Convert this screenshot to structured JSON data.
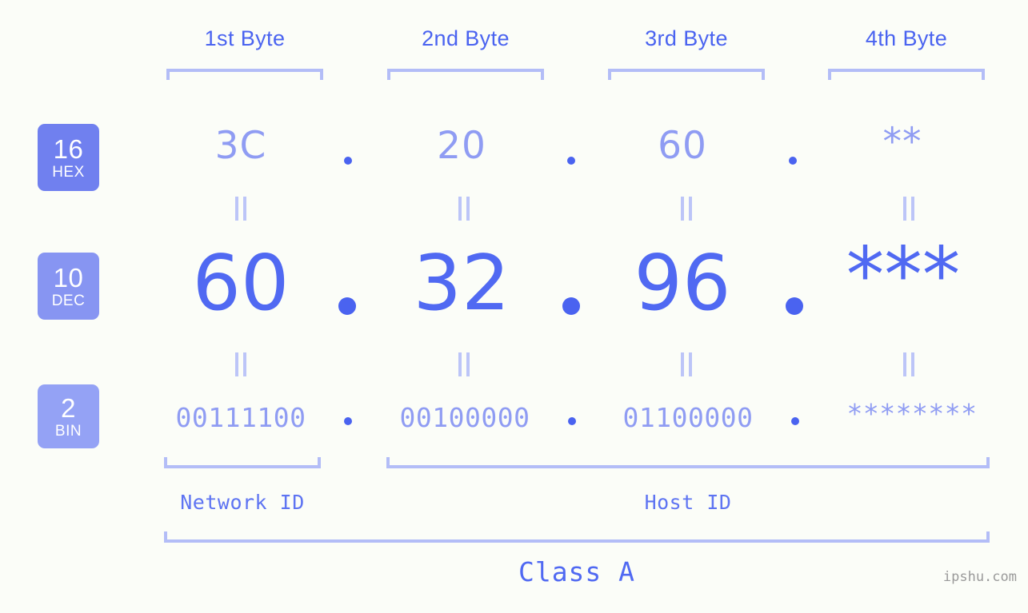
{
  "canvas": {
    "background": "#fbfdf8",
    "accent_strong": "#4a63f0",
    "accent_mid": "#8f9cf3",
    "accent_light": "#b3bdf7"
  },
  "byte_headers": [
    {
      "label": "1st Byte"
    },
    {
      "label": "2nd Byte"
    },
    {
      "label": "3rd Byte"
    },
    {
      "label": "4th Byte"
    }
  ],
  "rows": {
    "hex": {
      "badge_number": "16",
      "badge_name": "HEX",
      "badge_color": "#7080ef",
      "values": [
        "3C",
        "20",
        "60",
        "**"
      ],
      "separator": "."
    },
    "dec": {
      "badge_number": "10",
      "badge_name": "DEC",
      "badge_color": "#8795f2",
      "values": [
        "60",
        "32",
        "96",
        "***"
      ],
      "separator": "."
    },
    "bin": {
      "badge_number": "2",
      "badge_name": "BIN",
      "badge_color": "#94a2f5",
      "values": [
        "00111100",
        "00100000",
        "01100000",
        "********"
      ],
      "separator": "."
    }
  },
  "equality_marks": [
    "||",
    "||",
    "||",
    "||"
  ],
  "id_sections": [
    {
      "label": "Network ID"
    },
    {
      "label": "Host ID"
    }
  ],
  "class_label": "Class A",
  "watermark": "ipshu.com"
}
